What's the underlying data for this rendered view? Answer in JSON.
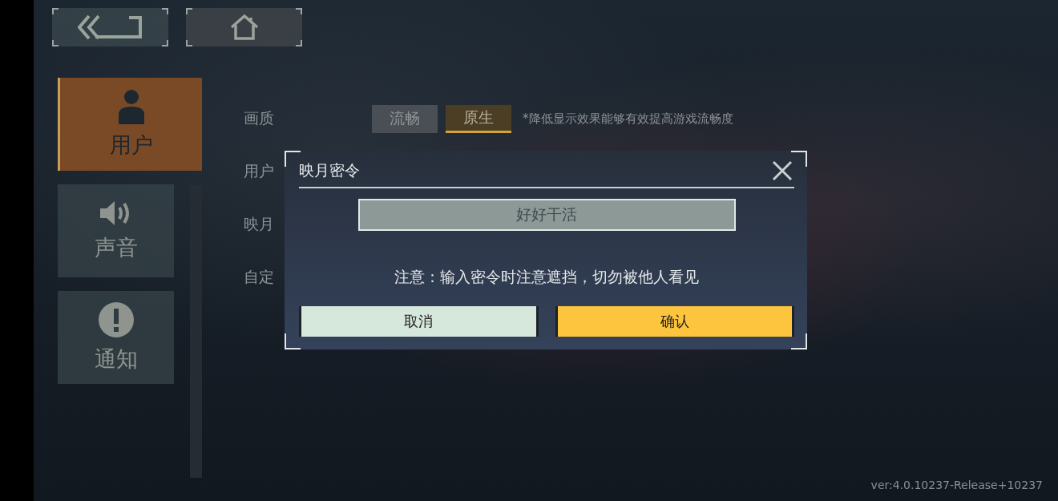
{
  "top_buttons": [
    {
      "kind": "back"
    },
    {
      "kind": "home"
    }
  ],
  "sidebar": {
    "items": [
      {
        "kind": "user",
        "label": "用户",
        "selected": true
      },
      {
        "kind": "sound",
        "label": "声音",
        "selected": false
      },
      {
        "kind": "notice",
        "label": "通知",
        "selected": false
      }
    ]
  },
  "settings": {
    "rows": [
      {
        "label": "画质",
        "options": [
          {
            "label": "流畅",
            "selected": false
          },
          {
            "label": "原生",
            "selected": true
          }
        ],
        "note": "*降低显示效果能够有效提高游戏流畅度"
      },
      {
        "label": "用户"
      },
      {
        "label": "映月"
      },
      {
        "label": "自定"
      }
    ]
  },
  "dialog": {
    "title": "映月密令",
    "input": {
      "value": "好好干活"
    },
    "notice": "注意：输入密令时注意遮挡，切勿被他人看见",
    "buttons": [
      {
        "kind": "cancel",
        "label": "取消"
      },
      {
        "kind": "confirm",
        "label": "确认"
      }
    ]
  },
  "version": "ver:4.0.10237-Release+10237"
}
